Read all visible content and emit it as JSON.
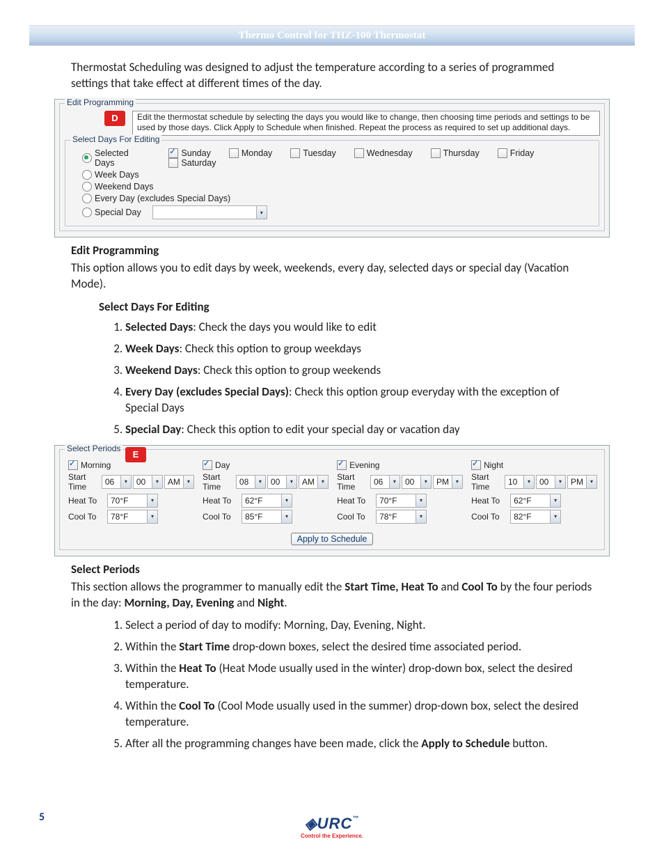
{
  "header_title": "Thermo Control for THZ-100 Thermostat",
  "intro_text": "Thermostat Scheduling was designed to adjust the temperature according to a series of programmed settings that take effect at different times of the day.",
  "screenshot_d": {
    "badge": "D",
    "fieldset_legend": "Edit Programming",
    "tip_text": "Edit the thermostat schedule by selecting the days you would like to change, then choosing time periods and settings to be used by those days.  Click Apply to Schedule when finished.  Repeat the process as required to set up additional days.",
    "inner_legend": "Select Days For Editing",
    "radio_selected_days": "Selected Days",
    "days": [
      {
        "label": "Sunday",
        "checked": true
      },
      {
        "label": "Monday",
        "checked": false
      },
      {
        "label": "Tuesday",
        "checked": false
      },
      {
        "label": "Wednesday",
        "checked": false
      },
      {
        "label": "Thursday",
        "checked": false
      },
      {
        "label": "Friday",
        "checked": false
      },
      {
        "label": "Saturday",
        "checked": false
      }
    ],
    "radio_week_days": "Week Days",
    "radio_weekend_days": "Weekend Days",
    "radio_every_day": "Every Day (excludes Special Days)",
    "radio_special_day": "Special Day"
  },
  "edit_prog_heading": "Edit Programming",
  "edit_prog_text": "This option allows you to edit days by week, weekends, every day, selected days or special day (Vacation Mode).",
  "select_days_heading": "Select Days For Editing",
  "select_days_items": [
    {
      "bold": "Selected Days",
      "text": ": Check the days you would like to edit"
    },
    {
      "bold": "Week Days",
      "text": ": Check this option to group weekdays"
    },
    {
      "bold": "Weekend Days",
      "text": ": Check this option to group weekends"
    },
    {
      "bold": "Every Day (excludes Special Days)",
      "text": ": Check this option group everyday with the exception of Special Days"
    },
    {
      "bold": "Special Day",
      "text": ": Check this option to edit your special day or vacation day"
    }
  ],
  "screenshot_e": {
    "badge": "E",
    "fieldset_legend": "Select Periods",
    "start_time_label": "Start Time",
    "heat_to_label": "Heat To",
    "cool_to_label": "Cool To",
    "apply_label": "Apply to Schedule",
    "periods": [
      {
        "name": "Morning",
        "checked": true,
        "hour": "06",
        "min": "00",
        "ampm": "AM",
        "heat": "70°F",
        "cool": "78°F"
      },
      {
        "name": "Day",
        "checked": true,
        "hour": "08",
        "min": "00",
        "ampm": "AM",
        "heat": "62°F",
        "cool": "85°F"
      },
      {
        "name": "Evening",
        "checked": true,
        "hour": "06",
        "min": "00",
        "ampm": "PM",
        "heat": "70°F",
        "cool": "78°F"
      },
      {
        "name": "Night",
        "checked": true,
        "hour": "10",
        "min": "00",
        "ampm": "PM",
        "heat": "62°F",
        "cool": "82°F"
      }
    ]
  },
  "select_periods_heading": "Select Periods",
  "select_periods_intro_parts": {
    "t1": "This section allows the programmer to manually edit the ",
    "b1": "Start Time, Heat To",
    "t2": " and ",
    "b2": "Cool To",
    "t3": " by the four periods in the day: ",
    "b3": "Morning, Day, Evening",
    "t4": " and ",
    "b4": "Night",
    "t5": "."
  },
  "select_periods_items": [
    {
      "pre": "Select a period of day to modify: Morning, Day, Evening, Night.",
      "bold": "",
      "post": ""
    },
    {
      "pre": "Within the ",
      "bold": "Start Time",
      "post": " drop-down boxes, select the desired time associated period."
    },
    {
      "pre": "Within the ",
      "bold": "Heat To",
      "post": " (Heat Mode usually used in the winter) drop-down box, select the desired temperature."
    },
    {
      "pre": "Within the ",
      "bold": "Cool To",
      "post": " (Cool Mode usually used in the summer) drop-down box, select the desired temperature."
    },
    {
      "pre": "After all the programming changes have been made, click the ",
      "bold": "Apply to Schedule",
      "post": " button."
    }
  ],
  "logo_main": "◈URC",
  "logo_sub": "Control the Experience.",
  "page_number": "5",
  "tm": "™"
}
